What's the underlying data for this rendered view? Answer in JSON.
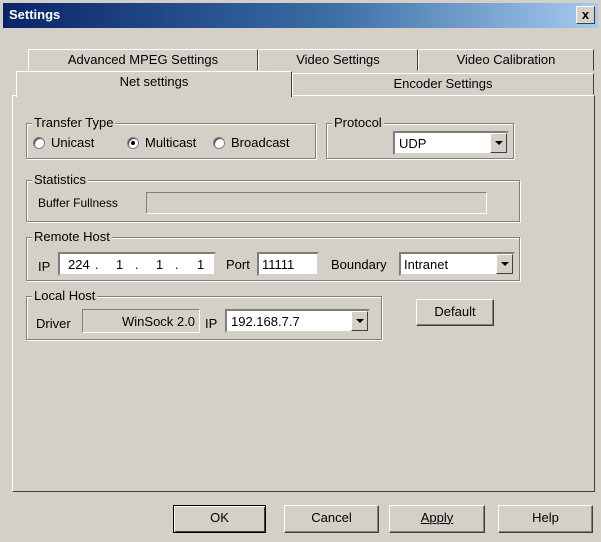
{
  "window": {
    "title": "Settings",
    "close_label": "x"
  },
  "tabs": {
    "row_back": [
      "Advanced MPEG Settings",
      "Video Settings",
      "Video Calibration"
    ],
    "row_front": [
      "Net settings",
      "Encoder Settings"
    ],
    "active": "Net settings"
  },
  "transfer_type": {
    "label": "Transfer Type",
    "options": [
      "Unicast",
      "Multicast",
      "Broadcast"
    ],
    "selected": "Multicast"
  },
  "protocol": {
    "label": "Protocol",
    "value": "UDP"
  },
  "statistics": {
    "label": "Statistics",
    "buffer_label": "Buffer Fullness",
    "buffer_fill": 0
  },
  "remote_host": {
    "label": "Remote Host",
    "ip_label": "IP",
    "ip_octets": [
      "224",
      "1",
      "1",
      "1"
    ],
    "port_label": "Port",
    "port_value": "11111",
    "boundary_label": "Boundary",
    "boundary_value": "Intranet"
  },
  "local_host": {
    "label": "Local Host",
    "driver_label": "Driver",
    "driver_value": "WinSock 2.0",
    "ip_label": "IP",
    "ip_value": "192.168.7.7"
  },
  "buttons": {
    "default": "Default",
    "ok": "OK",
    "cancel": "Cancel",
    "apply": "Apply",
    "help": "Help"
  }
}
